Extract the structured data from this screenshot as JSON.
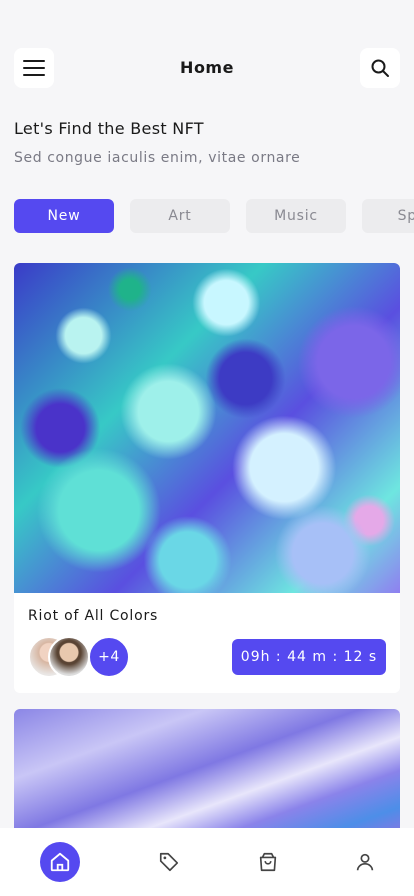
{
  "header": {
    "title": "Home",
    "menu_icon": "hamburger-menu-icon",
    "search_icon": "search-icon"
  },
  "intro": {
    "title": "Let's Find the Best NFT",
    "subtitle": "Sed congue iaculis enim, vitae ornare"
  },
  "tabs": [
    {
      "label": "New",
      "active": true
    },
    {
      "label": "Art",
      "active": false
    },
    {
      "label": "Music",
      "active": false
    },
    {
      "label": "Spo",
      "active": false
    }
  ],
  "cards": [
    {
      "title": "Riot of All Colors",
      "more_count": "+4",
      "timer": "09h : 44 m : 12 s"
    },
    {
      "title": "",
      "more_count": "",
      "timer": ""
    }
  ],
  "bottom_nav": [
    {
      "icon": "home-icon",
      "active": true
    },
    {
      "icon": "tag-icon",
      "active": false
    },
    {
      "icon": "shopping-bag-icon",
      "active": false
    },
    {
      "icon": "user-icon",
      "active": false
    }
  ],
  "colors": {
    "accent": "#5549f0",
    "background": "#f6f6f8",
    "tab_inactive": "#ececee"
  }
}
